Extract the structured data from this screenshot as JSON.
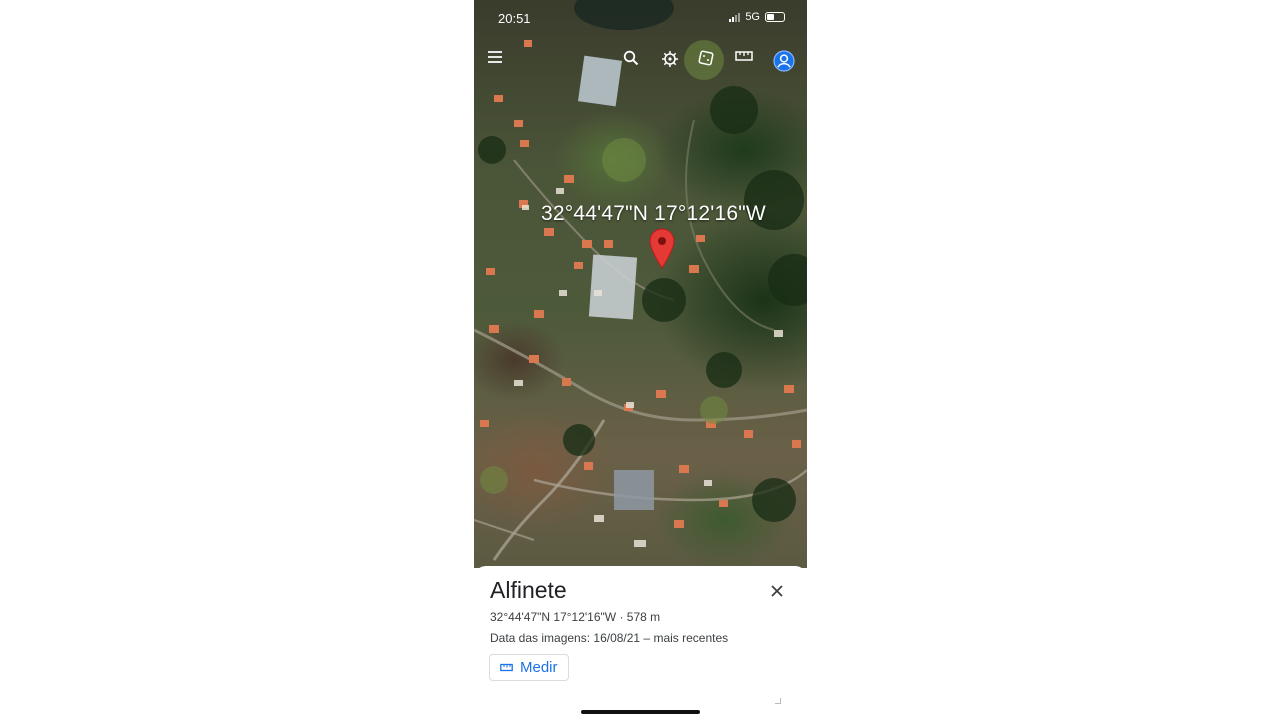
{
  "status_bar": {
    "time": "20:51",
    "network": "5G"
  },
  "toolbar": {
    "icons": [
      "menu-icon",
      "search-icon",
      "voyager-wheel-icon",
      "dice-icon",
      "ruler-icon",
      "account-icon"
    ],
    "accent_color": "#1a73e8"
  },
  "map": {
    "coordinates_label": "32°44'47\"N 17°12'16\"W",
    "pin_color": "#e53935"
  },
  "place_card": {
    "title": "Alfinete",
    "coords_altitude": "32°44'47\"N 17°12'16\"W · 578 m",
    "imagery_date": "Data das imagens: 16/08/21 – mais recentes",
    "measure_label": "Medir"
  }
}
